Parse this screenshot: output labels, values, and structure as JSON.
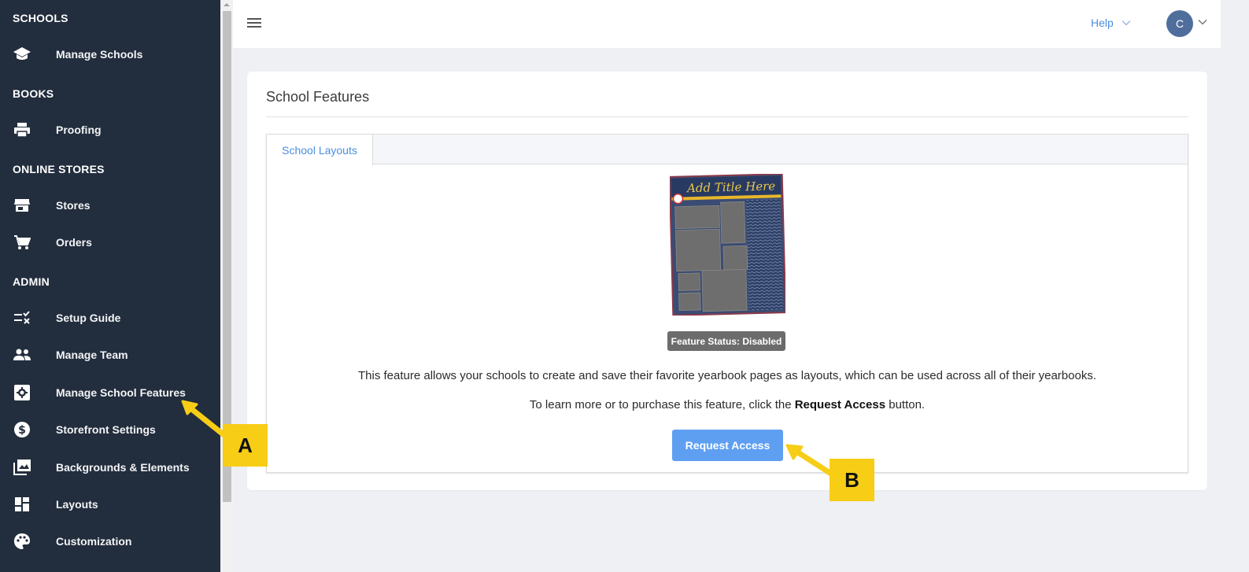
{
  "sidebar": {
    "sections": [
      {
        "heading": "SCHOOLS"
      },
      {
        "heading": "BOOKS"
      },
      {
        "heading": "ONLINE STORES"
      },
      {
        "heading": "ADMIN"
      }
    ],
    "items": [
      {
        "label": "Manage Schools",
        "icon": "graduation-cap-icon"
      },
      {
        "label": "Proofing",
        "icon": "printer-icon"
      },
      {
        "label": "Stores",
        "icon": "storefront-icon"
      },
      {
        "label": "Orders",
        "icon": "cart-icon"
      },
      {
        "label": "Setup Guide",
        "icon": "checklist-icon"
      },
      {
        "label": "Manage Team",
        "icon": "people-icon"
      },
      {
        "label": "Manage School Features",
        "icon": "settings-box-icon"
      },
      {
        "label": "Storefront Settings",
        "icon": "dollar-circle-icon"
      },
      {
        "label": "Backgrounds & Elements",
        "icon": "photo-library-icon"
      },
      {
        "label": "Layouts",
        "icon": "dashboard-icon"
      },
      {
        "label": "Customization",
        "icon": "palette-icon"
      }
    ]
  },
  "topbar": {
    "help_label": "Help",
    "avatar_initial": "C"
  },
  "main": {
    "title": "School Features",
    "tabs": [
      {
        "label": "School Layouts",
        "active": true
      }
    ],
    "status_badge": "Feature Status: Disabled",
    "description": "This feature allows your schools to create and save their favorite yearbook pages as layouts, which can be used across all of their yearbooks.",
    "learn_prefix": "To learn more or to purchase this feature, click the ",
    "learn_bold": "Request Access",
    "learn_suffix": " button.",
    "request_button": "Request Access",
    "preview_title": "Add Title Here"
  },
  "annotations": [
    {
      "label": "A"
    },
    {
      "label": "B"
    }
  ],
  "colors": {
    "sidebar_bg": "#222d3d",
    "accent_blue": "#4a8fe0",
    "button_blue": "#5e9ff2",
    "callout_yellow": "#f7cd16",
    "avatar_bg": "#4f6e9c"
  }
}
